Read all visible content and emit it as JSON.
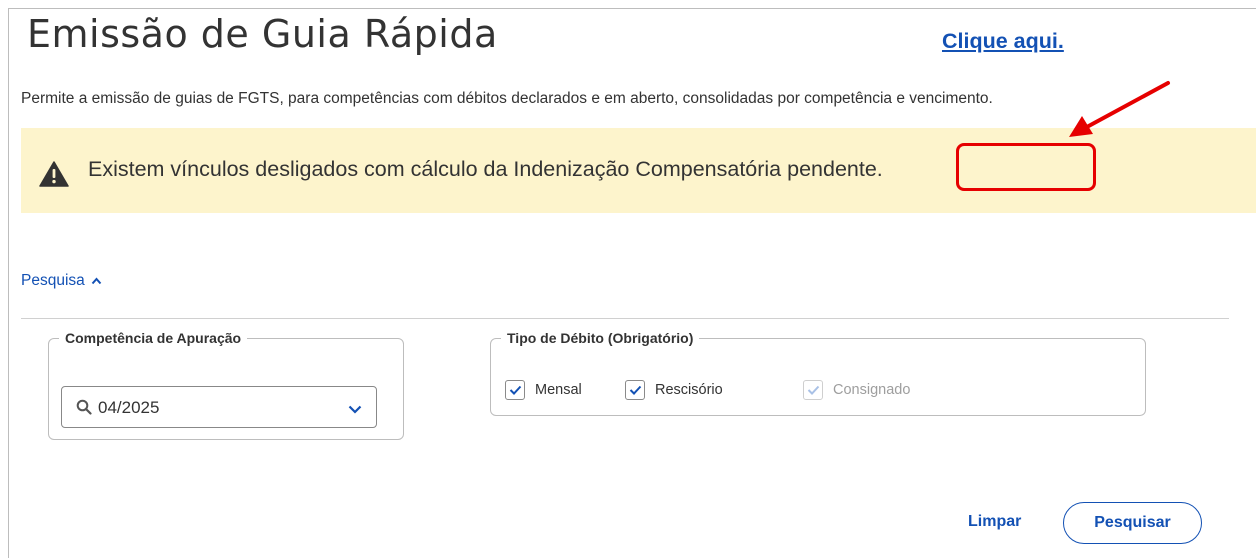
{
  "page": {
    "title": "Emissão de Guia Rápida",
    "description": "Permite a emissão de guias de FGTS, para competências com débitos declarados e em aberto, consolidadas por competência e vencimento."
  },
  "alert": {
    "message": "Existem vínculos desligados com cálculo da Indenização Compensatória pendente.",
    "link_label": "Clique aqui.",
    "icon": "warning-triangle-icon"
  },
  "search": {
    "toggle_label": "Pesquisa",
    "toggle_icon": "chevron-up-icon",
    "competencia": {
      "legend": "Competência de Apuração",
      "value": "04/2025"
    },
    "tipo_debito": {
      "legend": "Tipo de Débito (Obrigatório)",
      "options": [
        {
          "label": "Mensal",
          "checked": true,
          "disabled": false
        },
        {
          "label": "Rescisório",
          "checked": true,
          "disabled": false
        },
        {
          "label": "Consignado",
          "checked": true,
          "disabled": true
        }
      ]
    }
  },
  "actions": {
    "clear_label": "Limpar",
    "search_label": "Pesquisar"
  },
  "colors": {
    "primary": "#1351b4",
    "alert_bg": "#fdf4cc",
    "annotation": "#e60000"
  }
}
